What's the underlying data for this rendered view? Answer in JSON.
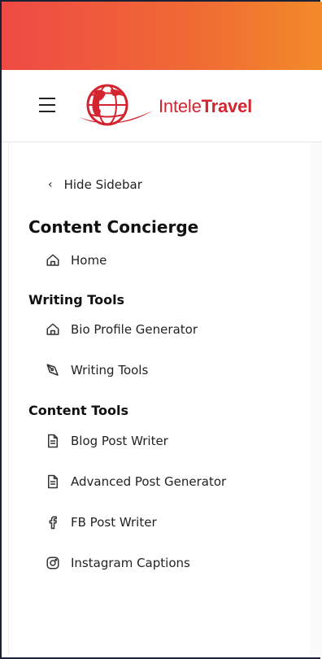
{
  "brand": {
    "name_light": "Intele",
    "name_bold": "Travel"
  },
  "header": {
    "menu_icon": "hamburger-icon"
  },
  "sidebar": {
    "hide_label": "Hide Sidebar",
    "title": "Content Concierge",
    "home": {
      "label": "Home",
      "icon": "home-icon"
    },
    "writing_section": "Writing Tools",
    "writing_items": [
      {
        "label": "Bio Profile Generator",
        "icon": "home-icon"
      },
      {
        "label": "Writing Tools",
        "icon": "pen-tool-icon"
      }
    ],
    "content_section": "Content Tools",
    "content_items": [
      {
        "label": "Blog Post Writer",
        "icon": "document-icon"
      },
      {
        "label": "Advanced Post Generator",
        "icon": "document-icon"
      },
      {
        "label": "FB Post Writer",
        "icon": "facebook-icon"
      },
      {
        "label": "Instagram Captions",
        "icon": "instagram-icon"
      }
    ]
  },
  "colors": {
    "gradient_start": "#ef4a45",
    "gradient_end": "#f28a2a",
    "brand_red": "#d42430"
  }
}
